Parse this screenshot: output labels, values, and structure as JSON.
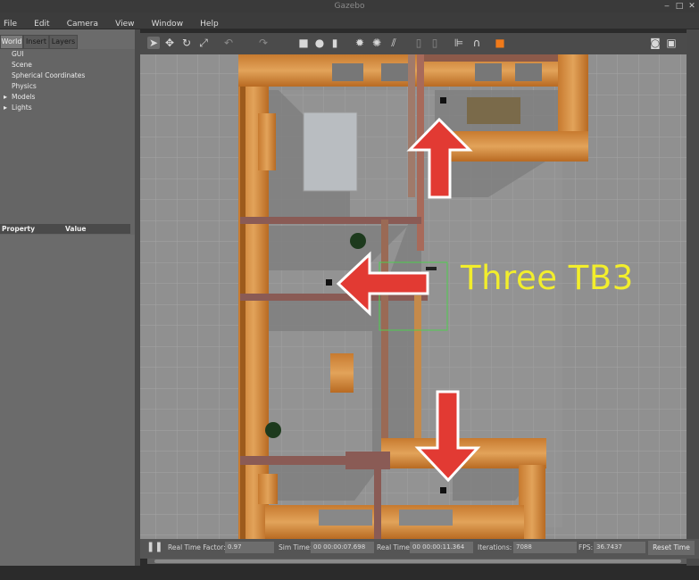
{
  "window": {
    "title": "Gazebo"
  },
  "menu": [
    "File",
    "Edit",
    "Camera",
    "View",
    "Window",
    "Help"
  ],
  "tabs": [
    "World",
    "Insert",
    "Layers"
  ],
  "tree": {
    "items": [
      {
        "label": "GUI",
        "expandable": false
      },
      {
        "label": "Scene",
        "expandable": false
      },
      {
        "label": "Spherical Coordinates",
        "expandable": false
      },
      {
        "label": "Physics",
        "expandable": false
      },
      {
        "label": "Models",
        "expandable": true
      },
      {
        "label": "Lights",
        "expandable": true
      }
    ]
  },
  "properties": {
    "col_property": "Property",
    "col_value": "Value"
  },
  "toolbar": {
    "icons": [
      "select-arrow-icon",
      "translate-icon",
      "rotate-icon",
      "scale-icon",
      "undo-icon",
      "redo-icon",
      "box-icon",
      "sphere-icon",
      "cylinder-icon",
      "point-light-icon",
      "spot-light-icon",
      "directional-light-icon",
      "copy-icon",
      "paste-icon",
      "align-icon",
      "snap-icon",
      "orange-mode-icon",
      "screenshot-icon",
      "save-icon"
    ]
  },
  "annotation": {
    "text": "Three TB3",
    "color": "#f2ee2c"
  },
  "status": {
    "rtf_label": "Real Time Factor:",
    "rtf_value": "0.97",
    "sim_label": "Sim Time:",
    "sim_value": "00 00:00:07.698",
    "real_label": "Real Time:",
    "real_value": "00 00:00:11.364",
    "iter_label": "Iterations:",
    "iter_value": "7088",
    "fps_label": "FPS:",
    "fps_value": "36.7437",
    "reset_label": "Reset Time"
  }
}
